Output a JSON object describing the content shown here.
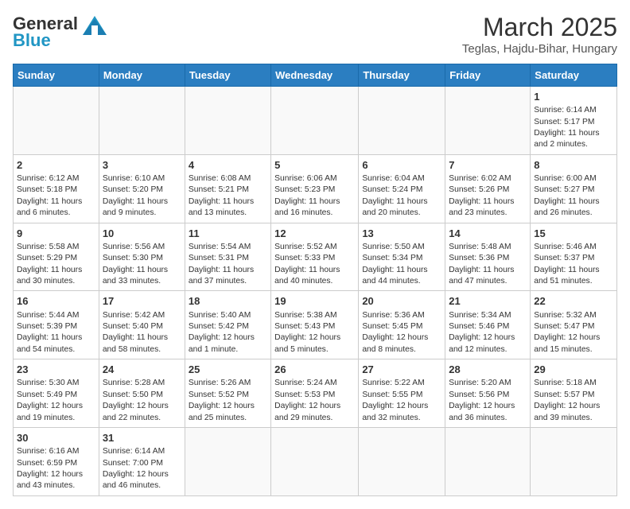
{
  "logo": {
    "text_general": "General",
    "text_blue": "Blue"
  },
  "title": {
    "month_year": "March 2025",
    "location": "Teglas, Hajdu-Bihar, Hungary"
  },
  "weekdays": [
    "Sunday",
    "Monday",
    "Tuesday",
    "Wednesday",
    "Thursday",
    "Friday",
    "Saturday"
  ],
  "weeks": [
    [
      {
        "day": "",
        "info": ""
      },
      {
        "day": "",
        "info": ""
      },
      {
        "day": "",
        "info": ""
      },
      {
        "day": "",
        "info": ""
      },
      {
        "day": "",
        "info": ""
      },
      {
        "day": "",
        "info": ""
      },
      {
        "day": "1",
        "info": "Sunrise: 6:14 AM\nSunset: 5:17 PM\nDaylight: 11 hours and 2 minutes."
      }
    ],
    [
      {
        "day": "2",
        "info": "Sunrise: 6:12 AM\nSunset: 5:18 PM\nDaylight: 11 hours and 6 minutes."
      },
      {
        "day": "3",
        "info": "Sunrise: 6:10 AM\nSunset: 5:20 PM\nDaylight: 11 hours and 9 minutes."
      },
      {
        "day": "4",
        "info": "Sunrise: 6:08 AM\nSunset: 5:21 PM\nDaylight: 11 hours and 13 minutes."
      },
      {
        "day": "5",
        "info": "Sunrise: 6:06 AM\nSunset: 5:23 PM\nDaylight: 11 hours and 16 minutes."
      },
      {
        "day": "6",
        "info": "Sunrise: 6:04 AM\nSunset: 5:24 PM\nDaylight: 11 hours and 20 minutes."
      },
      {
        "day": "7",
        "info": "Sunrise: 6:02 AM\nSunset: 5:26 PM\nDaylight: 11 hours and 23 minutes."
      },
      {
        "day": "8",
        "info": "Sunrise: 6:00 AM\nSunset: 5:27 PM\nDaylight: 11 hours and 26 minutes."
      }
    ],
    [
      {
        "day": "9",
        "info": "Sunrise: 5:58 AM\nSunset: 5:29 PM\nDaylight: 11 hours and 30 minutes."
      },
      {
        "day": "10",
        "info": "Sunrise: 5:56 AM\nSunset: 5:30 PM\nDaylight: 11 hours and 33 minutes."
      },
      {
        "day": "11",
        "info": "Sunrise: 5:54 AM\nSunset: 5:31 PM\nDaylight: 11 hours and 37 minutes."
      },
      {
        "day": "12",
        "info": "Sunrise: 5:52 AM\nSunset: 5:33 PM\nDaylight: 11 hours and 40 minutes."
      },
      {
        "day": "13",
        "info": "Sunrise: 5:50 AM\nSunset: 5:34 PM\nDaylight: 11 hours and 44 minutes."
      },
      {
        "day": "14",
        "info": "Sunrise: 5:48 AM\nSunset: 5:36 PM\nDaylight: 11 hours and 47 minutes."
      },
      {
        "day": "15",
        "info": "Sunrise: 5:46 AM\nSunset: 5:37 PM\nDaylight: 11 hours and 51 minutes."
      }
    ],
    [
      {
        "day": "16",
        "info": "Sunrise: 5:44 AM\nSunset: 5:39 PM\nDaylight: 11 hours and 54 minutes."
      },
      {
        "day": "17",
        "info": "Sunrise: 5:42 AM\nSunset: 5:40 PM\nDaylight: 11 hours and 58 minutes."
      },
      {
        "day": "18",
        "info": "Sunrise: 5:40 AM\nSunset: 5:42 PM\nDaylight: 12 hours and 1 minute."
      },
      {
        "day": "19",
        "info": "Sunrise: 5:38 AM\nSunset: 5:43 PM\nDaylight: 12 hours and 5 minutes."
      },
      {
        "day": "20",
        "info": "Sunrise: 5:36 AM\nSunset: 5:45 PM\nDaylight: 12 hours and 8 minutes."
      },
      {
        "day": "21",
        "info": "Sunrise: 5:34 AM\nSunset: 5:46 PM\nDaylight: 12 hours and 12 minutes."
      },
      {
        "day": "22",
        "info": "Sunrise: 5:32 AM\nSunset: 5:47 PM\nDaylight: 12 hours and 15 minutes."
      }
    ],
    [
      {
        "day": "23",
        "info": "Sunrise: 5:30 AM\nSunset: 5:49 PM\nDaylight: 12 hours and 19 minutes."
      },
      {
        "day": "24",
        "info": "Sunrise: 5:28 AM\nSunset: 5:50 PM\nDaylight: 12 hours and 22 minutes."
      },
      {
        "day": "25",
        "info": "Sunrise: 5:26 AM\nSunset: 5:52 PM\nDaylight: 12 hours and 25 minutes."
      },
      {
        "day": "26",
        "info": "Sunrise: 5:24 AM\nSunset: 5:53 PM\nDaylight: 12 hours and 29 minutes."
      },
      {
        "day": "27",
        "info": "Sunrise: 5:22 AM\nSunset: 5:55 PM\nDaylight: 12 hours and 32 minutes."
      },
      {
        "day": "28",
        "info": "Sunrise: 5:20 AM\nSunset: 5:56 PM\nDaylight: 12 hours and 36 minutes."
      },
      {
        "day": "29",
        "info": "Sunrise: 5:18 AM\nSunset: 5:57 PM\nDaylight: 12 hours and 39 minutes."
      }
    ],
    [
      {
        "day": "30",
        "info": "Sunrise: 6:16 AM\nSunset: 6:59 PM\nDaylight: 12 hours and 43 minutes."
      },
      {
        "day": "31",
        "info": "Sunrise: 6:14 AM\nSunset: 7:00 PM\nDaylight: 12 hours and 46 minutes."
      },
      {
        "day": "",
        "info": ""
      },
      {
        "day": "",
        "info": ""
      },
      {
        "day": "",
        "info": ""
      },
      {
        "day": "",
        "info": ""
      },
      {
        "day": "",
        "info": ""
      }
    ]
  ]
}
